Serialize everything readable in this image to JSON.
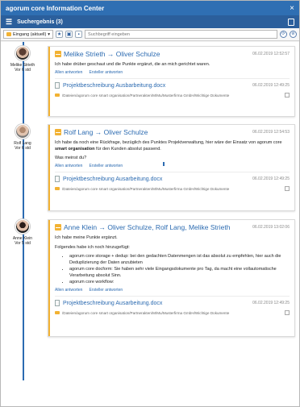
{
  "app": {
    "title": "agorum core Information Center",
    "close": "×"
  },
  "sub": {
    "title": "Suchergebnis (3)",
    "menu": "☰"
  },
  "toolbar": {
    "dropdown": "Eingang (aktuell)",
    "dropdown_arrow": "▾",
    "star": "★",
    "search_placeholder": "Suchbegriff eingeben",
    "refresh": "⟳",
    "clear": "⊘"
  },
  "entries": [
    {
      "author": "Melike Strieth",
      "ago": "Vor 6 std",
      "title": "Melike Strieth → Oliver Schulze",
      "date": "06.02.2019 12:52:57",
      "body": "Ich habe drüber geschaut und die Punkte ergänzt, die an mich gerichtet waren.",
      "reply_all": "Allen antworten",
      "reply": "Ersteller antworten",
      "attachment": "Projektbeschreibung Ausbarbeitung.docx",
      "attachment_date": "06.02.2019 12:49:25",
      "path": "/Dateien/agorum core smart organisation/Partnerakten/M/Mu/Musterfirma GmbH/Wichtige Dokumente"
    },
    {
      "author": "Rolf Lang",
      "ago": "Vor 6 std",
      "title": "Rolf Lang → Oliver Schulze",
      "date": "06.02.2019 12:54:53",
      "body_1": "Ich habe da noch eine Rückfrage, bezüglich des Punktes Projektverwaltung, hier wäre der Einsatz von agorum core",
      "body_bold": "smart organisation",
      "body_2": "für den Kunden absolut passend.",
      "body_3": "Was meinst du?",
      "reply_all": "Allen antworten",
      "reply": "Ersteller antworten",
      "attachment": "Projektbeschreibung Ausarbeitung.docx",
      "attachment_date": "06.02.2019 12:49:25",
      "path": "/Dateien/agorum core smart organisation/Partnerakten/M/Mu/Musterfirma GmbH/Wichtige Dokumente"
    },
    {
      "author": "Anne Klein",
      "ago": "Vor 5 std",
      "title": "Anne Klein → Oliver Schulze, Rolf Lang, Melike Strieth",
      "date": "06.02.2019 13:02:06",
      "body_1": "Ich habe meine Punkte ergänzt.",
      "body_2": "Folgendes habe ich noch hinzugefügt:",
      "bullets": [
        "agorum core storage + dedup: bei den gedachten Datenmengen ist das absolut zu empfehlen, hier auch die Deduplizierung der Daten anzubieten",
        "agorum core docform: Sie haben sehr viele Eingangsdokumente pro Tag, da macht eine vollautomatische Verarbeitung absolut Sinn.",
        "agorum core workflow:"
      ],
      "reply_all": "Allen antworten",
      "reply": "Ersteller antworten",
      "attachment": "Projektbeschreibung Ausarbeitung.docx",
      "attachment_date": "06.02.2019 12:49:25",
      "path": "/Dateien/agorum core smart organisation/Partnerakten/M/Mu/Musterfirma GmbH/Wichtige Dokumente"
    }
  ],
  "colors": {
    "accent": "#2c6bb1",
    "titlebar": "#2f6fb3",
    "highlight": "#f2b233"
  }
}
